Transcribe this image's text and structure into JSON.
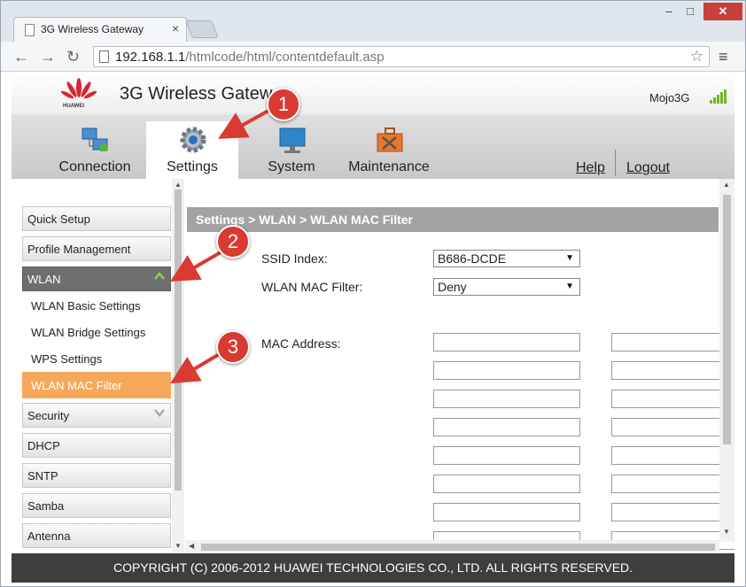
{
  "browser": {
    "tab_title": "3G Wireless Gateway",
    "tab_close": "×",
    "url_host": "192.168.1.1",
    "url_path": "/htmlcode/html/contentdefault.asp",
    "back": "←",
    "forward": "→",
    "reload": "↻",
    "star": "☆",
    "menu": "≡",
    "win_min": "–",
    "win_max": "□",
    "win_close": "✕"
  },
  "header": {
    "logo_text": "HUAWEI",
    "title": "3G Wireless Gatew",
    "user": "Mojo3G"
  },
  "nav": {
    "tabs": [
      {
        "label": "Connection",
        "icon": "connection-icon"
      },
      {
        "label": "Settings",
        "icon": "gear-icon",
        "active": true
      },
      {
        "label": "System",
        "icon": "monitor-icon"
      },
      {
        "label": "Maintenance",
        "icon": "toolbox-icon"
      }
    ],
    "help": "Help",
    "logout": "Logout"
  },
  "sidebar": {
    "items": [
      {
        "label": "Quick Setup"
      },
      {
        "label": "Profile Management"
      },
      {
        "label": "WLAN",
        "expanded": true
      },
      {
        "label": "Security"
      },
      {
        "label": "DHCP"
      },
      {
        "label": "SNTP"
      },
      {
        "label": "Samba"
      },
      {
        "label": "Antenna"
      }
    ],
    "wlan_sub": [
      {
        "label": "WLAN Basic Settings"
      },
      {
        "label": "WLAN Bridge Settings"
      },
      {
        "label": "WPS Settings"
      },
      {
        "label": "WLAN MAC Filter",
        "selected": true
      }
    ]
  },
  "main": {
    "breadcrumb": "Settings > WLAN > WLAN MAC Filter",
    "ssid_label": "SSID Index:",
    "ssid_value": "B686-DCDE",
    "filter_label": "WLAN MAC Filter:",
    "filter_value": "Deny",
    "mac_label": "MAC Address:"
  },
  "footer": "COPYRIGHT (C) 2006-2012 HUAWEI TECHNOLOGIES CO., LTD. ALL RIGHTS RESERVED.",
  "callouts": [
    "1",
    "2",
    "3"
  ],
  "colors": {
    "accent_orange": "#f6a85a",
    "callout_red": "#d93a32",
    "signal_green": "#74b52f"
  }
}
